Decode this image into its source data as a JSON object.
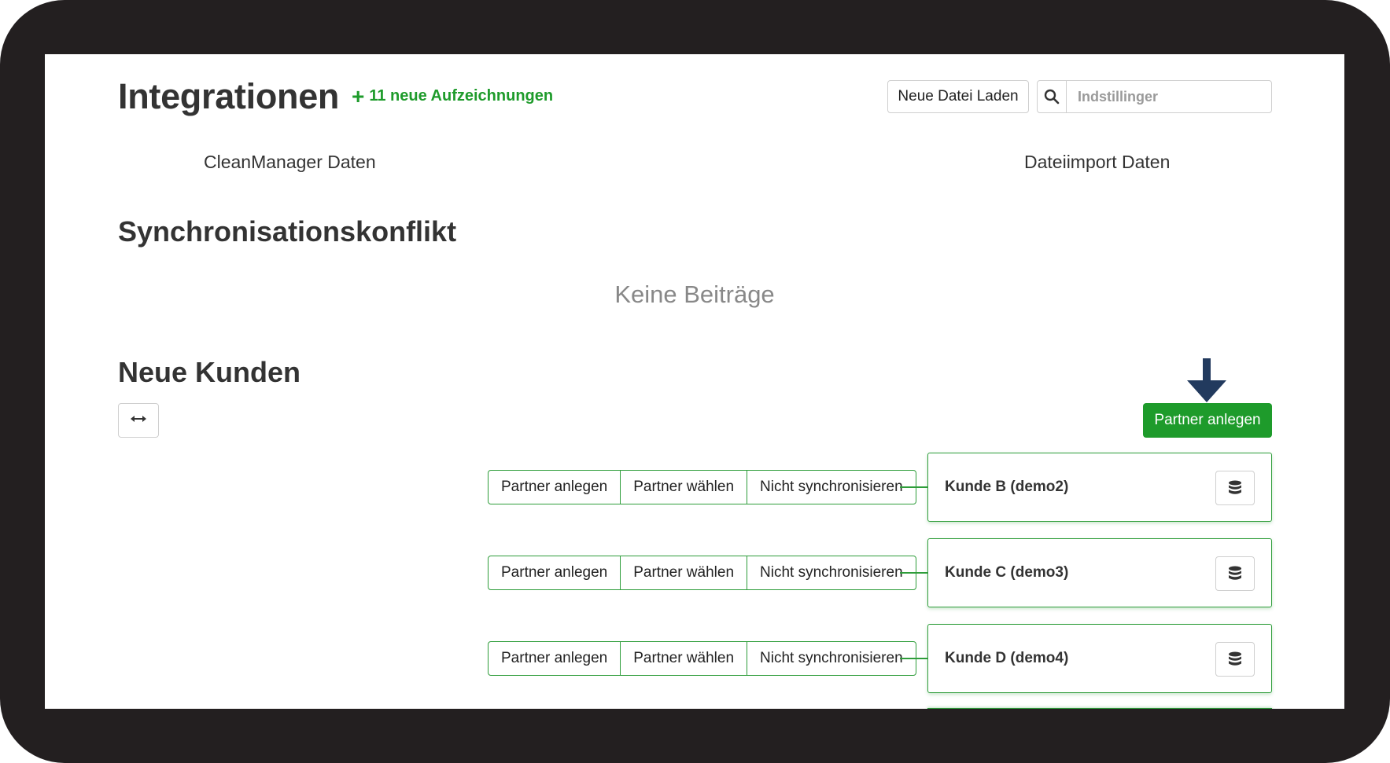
{
  "header": {
    "title": "Integrationen",
    "new_records": "11 neue Aufzeichnungen",
    "load_button": "Neue Datei Laden",
    "search_placeholder": "Indstillinger"
  },
  "columns": {
    "left": "CleanManager Daten",
    "right": "Dateiimport Daten"
  },
  "conflict": {
    "heading": "Synchronisationskonflikt",
    "empty_message": "Keine Beiträge"
  },
  "customers": {
    "heading": "Neue Kunden",
    "primary_button": "Partner anlegen",
    "actions": {
      "create": "Partner anlegen",
      "choose": "Partner wählen",
      "skip": "Nicht synchronisieren"
    },
    "rows": [
      {
        "name": "Kunde B (demo2)"
      },
      {
        "name": "Kunde C (demo3)"
      },
      {
        "name": "Kunde D (demo4)"
      }
    ]
  },
  "colors": {
    "accent_green": "#1e9b2b",
    "arrow_navy": "#223a5e",
    "frame": "#231f20"
  },
  "icons": [
    "plus-icon",
    "search-icon",
    "swap-horizontal-icon",
    "arrow-down-icon",
    "database-icon"
  ]
}
